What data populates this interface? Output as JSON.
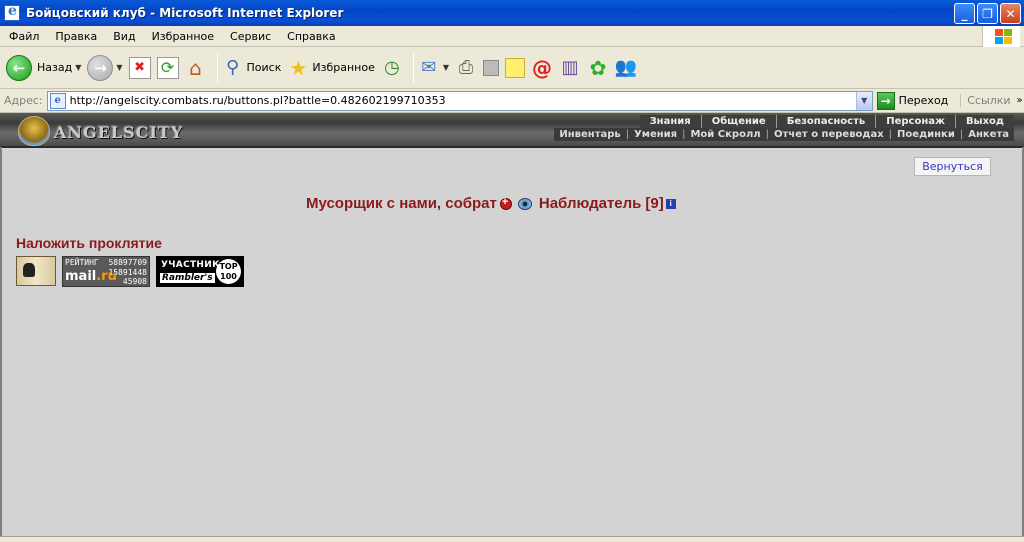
{
  "window": {
    "title": "Бойцовский клуб - Microsoft Internet Explorer",
    "controls": [
      "_",
      "❐",
      "✕"
    ]
  },
  "menu": [
    "Файл",
    "Правка",
    "Вид",
    "Избранное",
    "Сервис",
    "Справка"
  ],
  "toolbar": {
    "back_label": "Назад",
    "search_label": "Поиск",
    "favorites_label": "Избранное"
  },
  "address": {
    "label": "Адрес:",
    "url": "http://angelscity.combats.ru/buttons.pl?battle=0.482602199710353",
    "go_label": "Переход",
    "links_label": "Ссылки"
  },
  "game": {
    "logo": "ANGELSCITY",
    "nav_top": [
      "Знания",
      "Общение",
      "Безопасность",
      "Персонаж",
      "Выход"
    ],
    "nav_bottom": [
      "Инвентарь",
      "Умения",
      "Мой Скролл",
      "Отчет о переводах",
      "Поединки",
      "Анкета"
    ],
    "back_button": "Вернуться",
    "player_name": "Мусорщик с нами, собрат",
    "observer_label": "Наблюдатель",
    "observer_level": "[9]",
    "curse_title": "Наложить проклятие"
  },
  "counters": {
    "mailru_rating": "РЕЙТИНГ",
    "mailru_brand": "mail",
    "mailru_domain": ".ru",
    "mailru_n1": "58897709",
    "mailru_n2": "15891448",
    "mailru_n3": "45908",
    "rambler_top": "УЧАСТНИК",
    "rambler_name": "Rambler's",
    "rambler_badge_1": "TOP",
    "rambler_badge_2": "100"
  }
}
